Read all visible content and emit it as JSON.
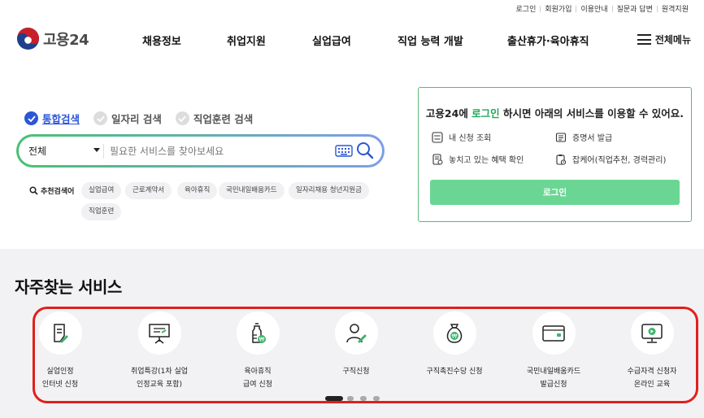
{
  "util_links": [
    "로그인",
    "회원가입",
    "이용안내",
    "질문과 답변",
    "원격지원"
  ],
  "logo": {
    "text": "고용24",
    "colors": [
      "#c8202b",
      "#1e3f8c"
    ]
  },
  "nav": [
    "채용정보",
    "취업지원",
    "실업급여",
    "직업 능력 개발",
    "출산휴가·육아휴직"
  ],
  "menu_all": "전체메뉴",
  "search": {
    "tabs": [
      "통합검색",
      "일자리 검색",
      "직업훈련 검색"
    ],
    "active_tab": "통합검색",
    "select_value": "전체",
    "placeholder": "필요한 서비스를 찾아보세요",
    "keyboard_icon": "keyboard-icon",
    "search_icon": "magnifier-icon"
  },
  "recommend": {
    "label": "추천검색어",
    "chips": [
      "실업급여",
      "근로계약서",
      "육아휴직",
      "국민내일배움카드",
      "일자리채용 청년지원금",
      "직업훈련"
    ]
  },
  "login_panel": {
    "title_pre": "고용24에 ",
    "title_link": "로그인",
    "title_post": " 하시면 아래의 서비스를 이용할 수 있어요.",
    "items": [
      "내 신청 조회",
      "증명서 발급",
      "놓치고 있는 혜택 확인",
      "잡케어(직업추천, 경력관리)"
    ],
    "button": "로그인",
    "accent": "#1fa85a"
  },
  "frequent": {
    "title": "자주찾는 서비스",
    "services": [
      {
        "label": "실업인정\n인터넷 신청",
        "icon": "document-edit-icon"
      },
      {
        "label": "취업특강(1차 실업\n인정교육 포함)",
        "icon": "presentation-board-icon"
      },
      {
        "label": "육아휴직\n급여 신청",
        "icon": "baby-bottle-icon"
      },
      {
        "label": "구직신청",
        "icon": "person-edit-icon"
      },
      {
        "label": "구직촉진수당 신청",
        "icon": "money-bag-icon"
      },
      {
        "label": "국민내일배움카드\n발급신청",
        "icon": "card-icon"
      },
      {
        "label": "수급자격 신청자\n온라인 교육",
        "icon": "monitor-play-icon"
      }
    ],
    "pagination": {
      "pages": 4,
      "current": 1
    },
    "highlight_color": "#e0201b"
  }
}
